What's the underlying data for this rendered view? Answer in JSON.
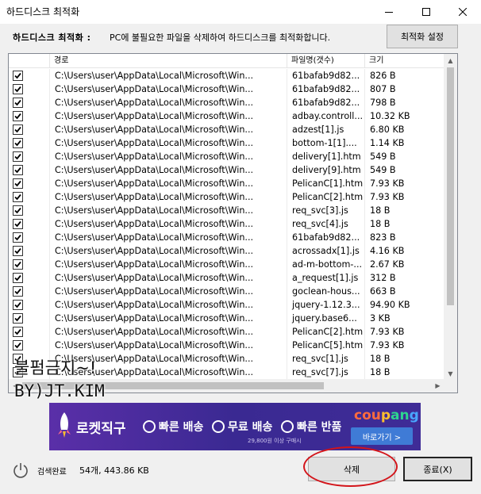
{
  "window": {
    "title": "하드디스크 최적화",
    "minimize_icon": "minimize-icon",
    "maximize_icon": "maximize-icon",
    "close_icon": "close-icon"
  },
  "top": {
    "label": "하드디스크 최적화 :",
    "description": "PC에 불필요한 파일을 삭제하여 하드디스크를 최적화합니다.",
    "settings_button": "최적화 설정"
  },
  "table": {
    "columns": [
      "",
      "경로",
      "파일명(갯수)",
      "크기"
    ],
    "rows": [
      {
        "checked": true,
        "path": "C:\\Users\\user\\AppData\\Local\\Microsoft\\Win...",
        "name": "61bafab9d82...",
        "size": "826 B"
      },
      {
        "checked": true,
        "path": "C:\\Users\\user\\AppData\\Local\\Microsoft\\Win...",
        "name": "61bafab9d82...",
        "size": "807 B"
      },
      {
        "checked": true,
        "path": "C:\\Users\\user\\AppData\\Local\\Microsoft\\Win...",
        "name": "61bafab9d82...",
        "size": "798 B"
      },
      {
        "checked": true,
        "path": "C:\\Users\\user\\AppData\\Local\\Microsoft\\Win...",
        "name": "adbay.controll...",
        "size": "10.32 KB"
      },
      {
        "checked": true,
        "path": "C:\\Users\\user\\AppData\\Local\\Microsoft\\Win...",
        "name": "adzest[1].js",
        "size": "6.80 KB"
      },
      {
        "checked": true,
        "path": "C:\\Users\\user\\AppData\\Local\\Microsoft\\Win...",
        "name": "bottom-1[1]....",
        "size": "1.14 KB"
      },
      {
        "checked": true,
        "path": "C:\\Users\\user\\AppData\\Local\\Microsoft\\Win...",
        "name": "delivery[1].htm",
        "size": "549 B"
      },
      {
        "checked": true,
        "path": "C:\\Users\\user\\AppData\\Local\\Microsoft\\Win...",
        "name": "delivery[9].htm",
        "size": "549 B"
      },
      {
        "checked": true,
        "path": "C:\\Users\\user\\AppData\\Local\\Microsoft\\Win...",
        "name": "PelicanC[1].htm",
        "size": "7.93 KB"
      },
      {
        "checked": true,
        "path": "C:\\Users\\user\\AppData\\Local\\Microsoft\\Win...",
        "name": "PelicanC[2].htm",
        "size": "7.93 KB"
      },
      {
        "checked": true,
        "path": "C:\\Users\\user\\AppData\\Local\\Microsoft\\Win...",
        "name": "req_svc[3].js",
        "size": "18 B"
      },
      {
        "checked": true,
        "path": "C:\\Users\\user\\AppData\\Local\\Microsoft\\Win...",
        "name": "req_svc[4].js",
        "size": "18 B"
      },
      {
        "checked": true,
        "path": "C:\\Users\\user\\AppData\\Local\\Microsoft\\Win...",
        "name": "61bafab9d82...",
        "size": "823 B"
      },
      {
        "checked": true,
        "path": "C:\\Users\\user\\AppData\\Local\\Microsoft\\Win...",
        "name": "acrossadx[1].js",
        "size": "4.16 KB"
      },
      {
        "checked": true,
        "path": "C:\\Users\\user\\AppData\\Local\\Microsoft\\Win...",
        "name": "ad-m-bottom-...",
        "size": "2.67 KB"
      },
      {
        "checked": true,
        "path": "C:\\Users\\user\\AppData\\Local\\Microsoft\\Win...",
        "name": "a_request[1].js",
        "size": "312 B"
      },
      {
        "checked": true,
        "path": "C:\\Users\\user\\AppData\\Local\\Microsoft\\Win...",
        "name": "goclean-hous...",
        "size": "663 B"
      },
      {
        "checked": true,
        "path": "C:\\Users\\user\\AppData\\Local\\Microsoft\\Win...",
        "name": "jquery-1.12.3...",
        "size": "94.90 KB"
      },
      {
        "checked": true,
        "path": "C:\\Users\\user\\AppData\\Local\\Microsoft\\Win...",
        "name": "jquery.base6...",
        "size": "3 KB"
      },
      {
        "checked": true,
        "path": "C:\\Users\\user\\AppData\\Local\\Microsoft\\Win...",
        "name": "PelicanC[2].htm",
        "size": "7.93 KB"
      },
      {
        "checked": true,
        "path": "C:\\Users\\user\\AppData\\Local\\Microsoft\\Win...",
        "name": "PelicanC[5].htm",
        "size": "7.93 KB"
      },
      {
        "checked": true,
        "path": "C:\\Users\\user\\AppData\\Local\\Microsoft\\Win...",
        "name": "req_svc[1].js",
        "size": "18 B"
      },
      {
        "checked": true,
        "path": "C:\\Users\\user\\AppData\\Local\\Microsoft\\Win...",
        "name": "req_svc[7].js",
        "size": "18 B"
      }
    ]
  },
  "watermark": {
    "line1": "불펌금지~!",
    "line2": "BY)JT.KIM"
  },
  "banner": {
    "brand": "로켓직구",
    "feature1": "빠른 배송",
    "feature2": "무료 배송",
    "feature2_sub": "29,800원 이상 구매시",
    "feature3": "빠른 반품",
    "logo": [
      "cou",
      "p",
      "an",
      "g"
    ],
    "button": "바로가기 >"
  },
  "status": {
    "icon": "power-icon",
    "label": "검색완료",
    "count": "54개, 443.86 KB"
  },
  "buttons": {
    "delete": "삭제",
    "close": "종료(X)"
  },
  "colors": {
    "highlight": "#d3141a",
    "banner_bg": "#3b2a93",
    "banner_button": "#3f7bd6"
  }
}
